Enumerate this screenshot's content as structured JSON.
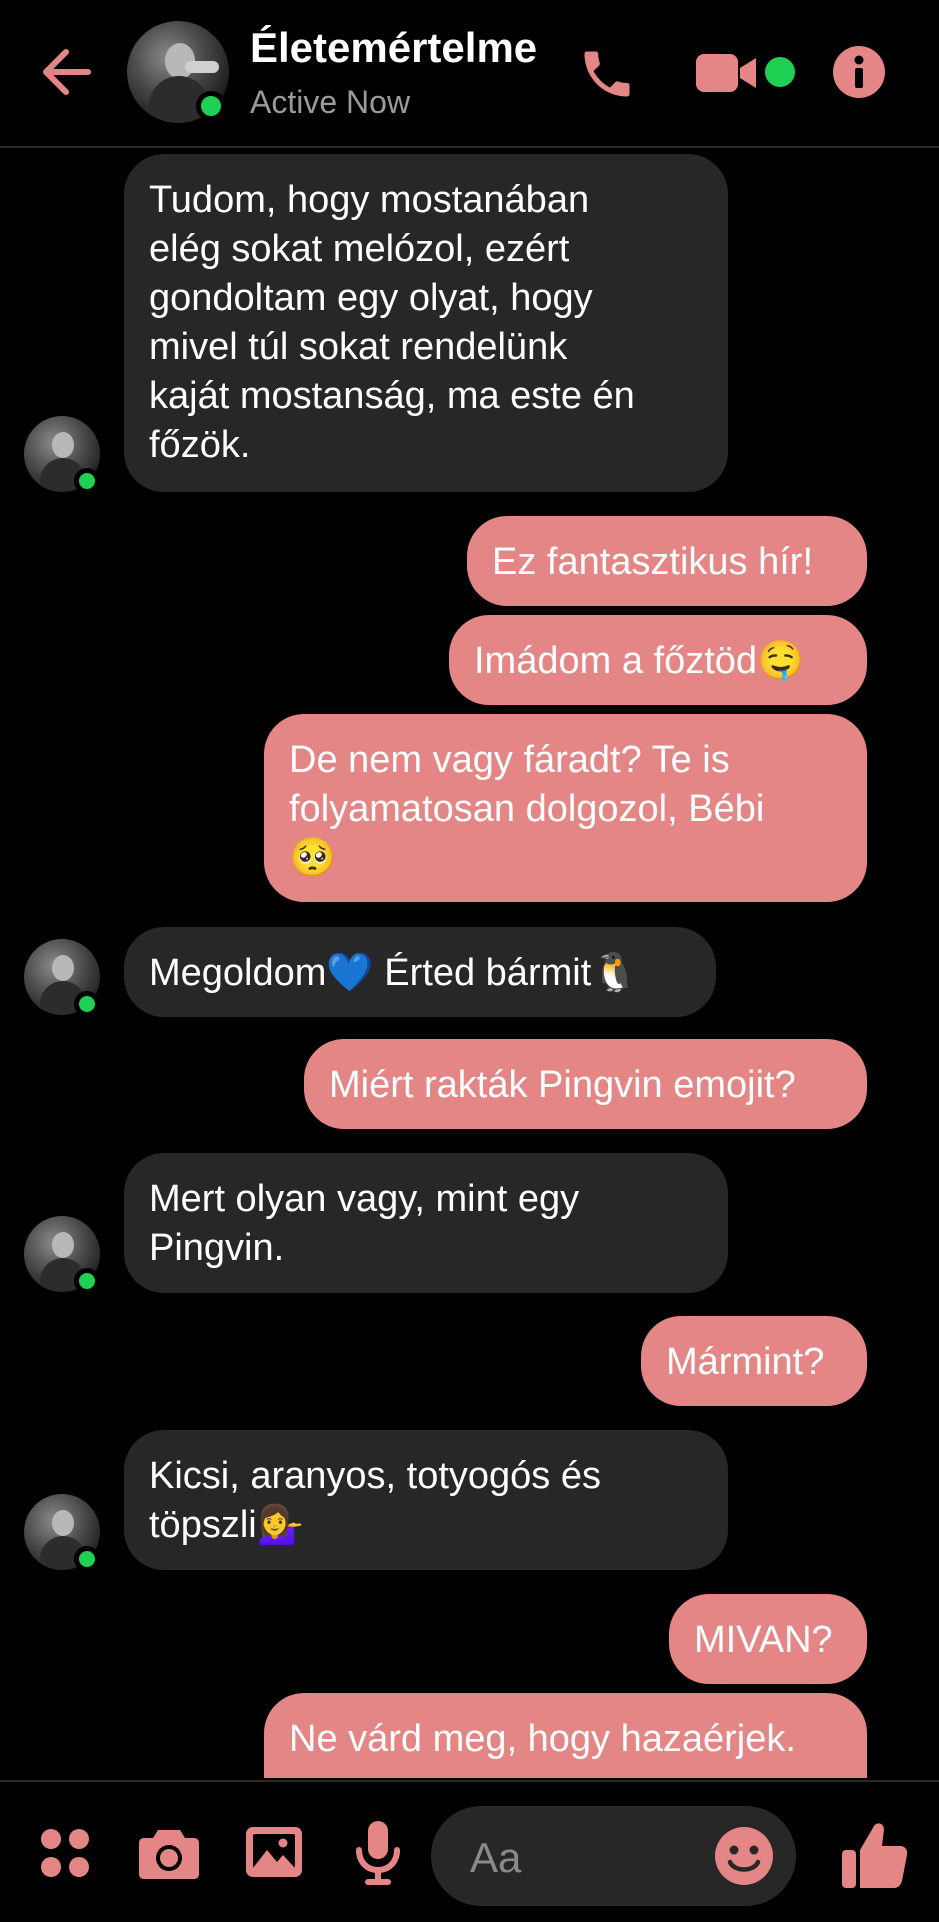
{
  "header": {
    "contact_name": "Életemértelme",
    "status": "Active Now"
  },
  "messages": [
    {
      "direction": "incoming",
      "text": "Tudom, hogy mostanában\nelég sokat melózol, ezért\ngondoltam egy olyat, hogy\nmivel túl sokat rendelünk\nkaját mostanság, ma este én\nfőzök."
    },
    {
      "direction": "outgoing",
      "text": "Ez fantasztikus hír!"
    },
    {
      "direction": "outgoing",
      "text": "Imádom a főztöd🤤"
    },
    {
      "direction": "outgoing",
      "text": "De nem vagy fáradt? Te is\nfolyamatosan dolgozol, Bébi\n🥺"
    },
    {
      "direction": "incoming",
      "text": "Megoldom💙 Érted bármit🐧"
    },
    {
      "direction": "outgoing",
      "text": "Miért rakták Pingvin emojit?"
    },
    {
      "direction": "incoming",
      "text": "Mert olyan vagy, mint egy\nPingvin."
    },
    {
      "direction": "outgoing",
      "text": "Mármint?"
    },
    {
      "direction": "incoming",
      "text": "Kicsi, aranyos, totyogós és\ntöpszli💁‍♀️"
    },
    {
      "direction": "outgoing",
      "text": "MIVAN?"
    },
    {
      "direction": "outgoing",
      "text": "Ne várd meg, hogy hazaérjek."
    }
  ],
  "composer": {
    "placeholder": "Aa"
  },
  "icons": {
    "back": "arrow-left-icon",
    "call": "phone-icon",
    "video": "video-camera-icon",
    "info": "info-icon",
    "apps": "apps-grid-icon",
    "camera": "camera-icon",
    "gallery": "image-icon",
    "mic": "microphone-icon",
    "emoji": "smiley-icon",
    "like": "thumbs-up-icon"
  },
  "colors": {
    "accent": "#e48686",
    "background": "#000000",
    "incoming_bubble": "#272727",
    "online": "#1fd052"
  }
}
